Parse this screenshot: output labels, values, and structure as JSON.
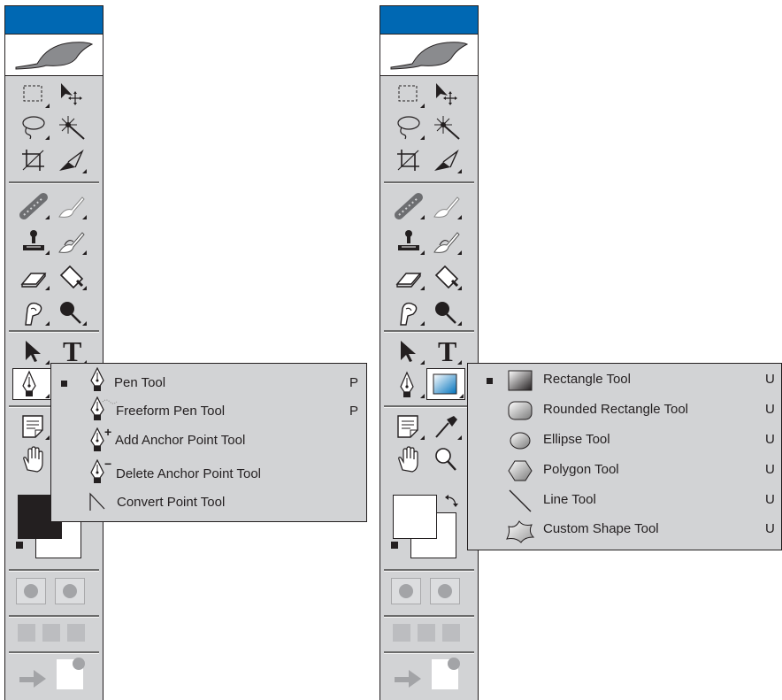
{
  "left_panel": {
    "active_tool": "pen-tool",
    "flyout": {
      "items": [
        {
          "label": "Pen Tool",
          "shortcut": "P",
          "selected": true,
          "icon": "pen-icon"
        },
        {
          "label": "Freeform Pen Tool",
          "shortcut": "P",
          "selected": false,
          "icon": "freeform-pen-icon"
        },
        {
          "label": "Add Anchor Point Tool",
          "shortcut": "",
          "selected": false,
          "icon": "add-anchor-point-icon"
        },
        {
          "label": "Delete Anchor Point Tool",
          "shortcut": "",
          "selected": false,
          "icon": "delete-anchor-point-icon"
        },
        {
          "label": "Convert Point Tool",
          "shortcut": "",
          "selected": false,
          "icon": "convert-point-icon"
        }
      ]
    },
    "add_anchor_glyph": "+",
    "delete_anchor_glyph": "−"
  },
  "right_panel": {
    "active_tool": "rectangle-tool",
    "flyout": {
      "items": [
        {
          "label": "Rectangle Tool",
          "shortcut": "U",
          "selected": true,
          "icon": "rectangle-icon"
        },
        {
          "label": "Rounded  Rectangle Tool",
          "shortcut": "U",
          "selected": false,
          "icon": "rounded-rectangle-icon"
        },
        {
          "label": "Ellipse Tool",
          "shortcut": "U",
          "selected": false,
          "icon": "ellipse-icon"
        },
        {
          "label": "Polygon Tool",
          "shortcut": "U",
          "selected": false,
          "icon": "polygon-icon"
        },
        {
          "label": "Line Tool",
          "shortcut": "U",
          "selected": false,
          "icon": "line-icon"
        },
        {
          "label": "Custom Shape Tool",
          "shortcut": "U",
          "selected": false,
          "icon": "custom-shape-icon"
        }
      ]
    }
  },
  "type_tool_glyph": "T",
  "colors": {
    "titlebar": "#0068b3",
    "panel_bg": "#d2d3d5",
    "foreground_swatch_left": "#231f20",
    "foreground_swatch_right": "#ffffff",
    "background_swatch": "#ffffff"
  }
}
